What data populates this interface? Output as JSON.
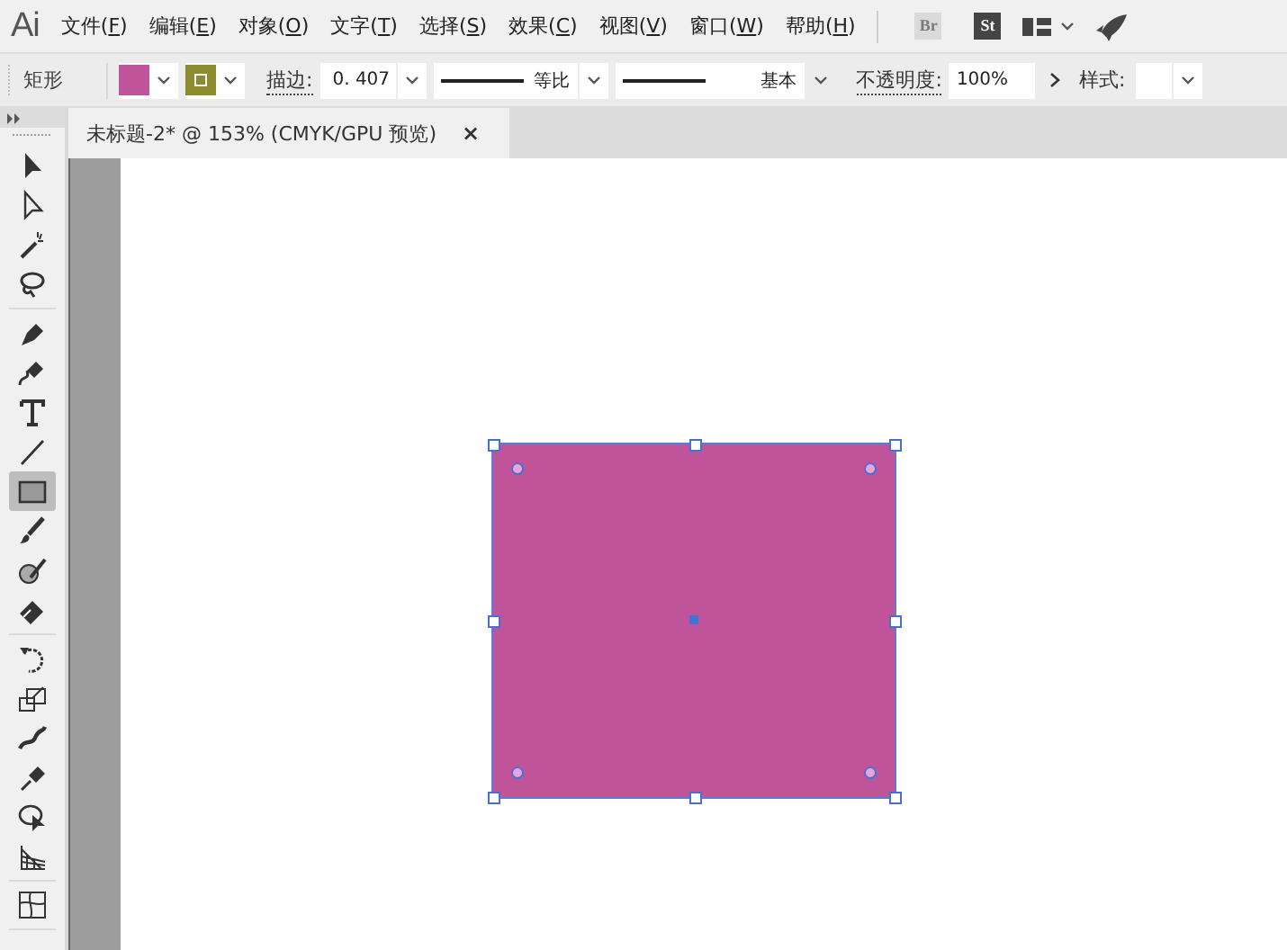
{
  "app_logo": "Ai",
  "menu": [
    {
      "label": "文件(F)"
    },
    {
      "label": "编辑(E)"
    },
    {
      "label": "对象(O)"
    },
    {
      "label": "文字(T)"
    },
    {
      "label": "选择(S)"
    },
    {
      "label": "效果(C)"
    },
    {
      "label": "视图(V)"
    },
    {
      "label": "窗口(W)"
    },
    {
      "label": "帮助(H)"
    }
  ],
  "app_buttons": [
    {
      "label": "Br",
      "disabled": true
    },
    {
      "label": "St",
      "disabled": false
    }
  ],
  "control_bar": {
    "object_type": "矩形",
    "swatches": [
      {
        "kind": "fill",
        "color": "#c0549b"
      },
      {
        "kind": "stroke",
        "color": "#8c8c2e"
      }
    ],
    "stroke_label": "描边:",
    "stroke_value": "0. 407",
    "stroke_style": "等比",
    "brush": "基本",
    "opacity_label": "不透明度:",
    "opacity_value": "100%",
    "style_label": "样式:"
  },
  "document_tab": {
    "title": "未标题-2* @ 153% (CMYK/GPU 预览)",
    "close": "×",
    "selected": true
  },
  "tool_groups": [
    [
      {
        "kind": "select",
        "selected": false
      },
      {
        "kind": "direct-select",
        "selected": false
      },
      {
        "kind": "magic-wand",
        "selected": false
      },
      {
        "kind": "lasso",
        "selected": false
      }
    ],
    [
      {
        "kind": "pen",
        "selected": false
      },
      {
        "kind": "curvature",
        "selected": false
      },
      {
        "kind": "type",
        "selected": false
      },
      {
        "kind": "line",
        "selected": false
      },
      {
        "kind": "rectangle",
        "selected": true
      },
      {
        "kind": "brush",
        "selected": false
      },
      {
        "kind": "shaper",
        "selected": false
      },
      {
        "kind": "eraser",
        "selected": false
      }
    ],
    [
      {
        "kind": "rotate",
        "selected": false
      },
      {
        "kind": "scale",
        "selected": false
      },
      {
        "kind": "warp",
        "selected": false
      },
      {
        "kind": "pin",
        "selected": false
      },
      {
        "kind": "shape-builder",
        "selected": false
      },
      {
        "kind": "perspective",
        "selected": false
      }
    ],
    [
      {
        "kind": "mesh",
        "selected": false
      }
    ]
  ],
  "artwork": {
    "kind": "rectangle",
    "selected": true
  }
}
